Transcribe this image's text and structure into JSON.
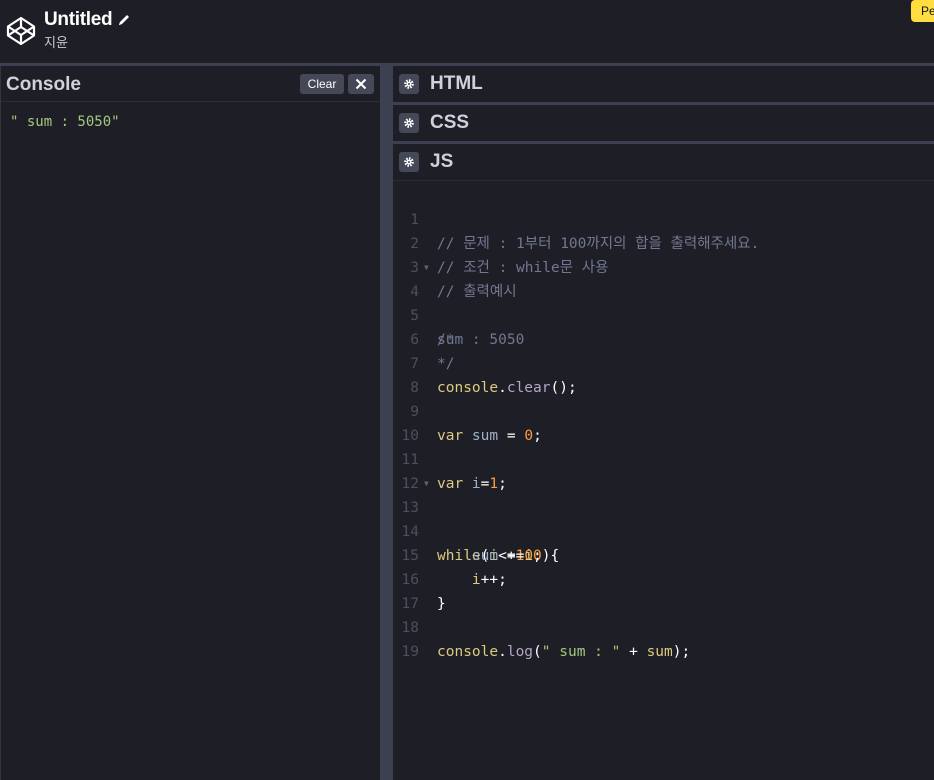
{
  "header": {
    "title": "Untitled",
    "author": "지윤",
    "pe_button": "Pe"
  },
  "console": {
    "title": "Console",
    "clear_label": "Clear",
    "output": "\" sum : 5050\""
  },
  "editors": {
    "html_title": "HTML",
    "css_title": "CSS",
    "js_title": "JS"
  },
  "code": {
    "line_numbers": [
      "1",
      "2",
      "3",
      "4",
      "5",
      "6",
      "7",
      "8",
      "9",
      "10",
      "11",
      "12",
      "13",
      "14",
      "15",
      "16",
      "17",
      "18",
      "19"
    ],
    "l1": "// 문제 : 1부터 100까지의 합을 출력해주세요.",
    "l2": "// 조건 : while문 사용",
    "l3": "// 출력예시",
    "l4": "/*",
    "l5": "sum : 5050",
    "l6": "*/",
    "l7_obj": "console",
    "l7_dot": ".",
    "l7_fn": "clear",
    "l7_end": "();",
    "l9_kw": "var",
    "l9_var": " sum",
    "l9_op": " = ",
    "l9_num": "0",
    "l9_end": ";",
    "l11_kw": "var",
    "l11_var": " i",
    "l11_op": "=",
    "l11_num": "1",
    "l11_end": ";",
    "l13_kw": "while",
    "l13_p1": "(",
    "l13_var": "i",
    "l13_op": "<=",
    "l13_num": "100",
    "l13_p2": "){",
    "l14_var": "    sum",
    "l14_op": " +=",
    "l14_var2": "i",
    "l14_end": ";",
    "l15_var": "    i",
    "l15_op": "++",
    "l15_end": ";",
    "l16": "}",
    "l18_obj": "console",
    "l18_dot": ".",
    "l18_fn": "log",
    "l18_p1": "(",
    "l18_str": "\" sum : \"",
    "l18_op": " + ",
    "l18_var": "sum",
    "l18_end": ");"
  },
  "colors": {
    "background": "#1e1f26",
    "separator": "#3d4051",
    "button": "#444857",
    "accent_yellow": "#ffdd40"
  },
  "icons": {
    "logo": "codepen-logo-icon",
    "edit": "pencil-icon",
    "close": "close-icon",
    "settings": "gear-icon"
  }
}
